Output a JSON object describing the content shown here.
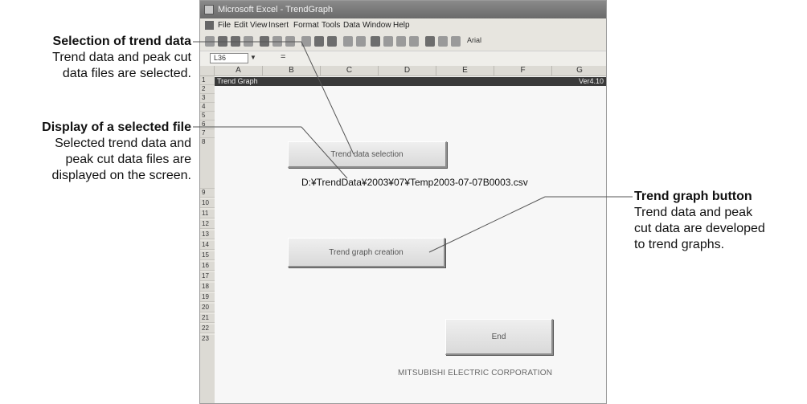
{
  "window": {
    "title": "Microsoft Excel - TrendGraph",
    "menu": [
      "File",
      "Edit",
      "View",
      "Insert",
      "Format",
      "Tools",
      "Data",
      "Window",
      "Help"
    ],
    "font_box": "Arial",
    "name_box": "L36",
    "formula_marker": "="
  },
  "sheet": {
    "columns": [
      "A",
      "B",
      "C",
      "D",
      "E",
      "F",
      "G"
    ],
    "rows": [
      "1",
      "2",
      "3",
      "4",
      "5",
      "6",
      "7",
      "8",
      "9",
      "10",
      "11",
      "12",
      "13",
      "14",
      "15",
      "16",
      "17",
      "18",
      "19",
      "20",
      "21",
      "22",
      "23"
    ],
    "title_left": "Trend Graph",
    "title_right": "Ver4.10",
    "btn_trend_data_selection": "Trend data selection",
    "selected_file": "D:¥TrendData¥2003¥07¥Temp2003-07-07B0003.csv",
    "btn_trend_graph_creation": "Trend graph creation",
    "btn_end": "End",
    "maker": "MITSUBISHI ELECTRIC CORPORATION"
  },
  "callouts": {
    "selection": {
      "title": "Selection of trend data",
      "lines": [
        "Trend data and peak cut",
        "data files are selected."
      ]
    },
    "display": {
      "title": "Display of a selected file",
      "lines": [
        "Selected trend data and",
        "peak cut data files are",
        "displayed on the screen."
      ]
    },
    "graph": {
      "title": "Trend graph button",
      "lines": [
        "Trend data and peak",
        "cut data are developed",
        "to trend graphs."
      ]
    }
  },
  "colors": {
    "callout_line": "#555555",
    "title_row": "#3a3a3a",
    "window_bg": "#e7e5df"
  }
}
